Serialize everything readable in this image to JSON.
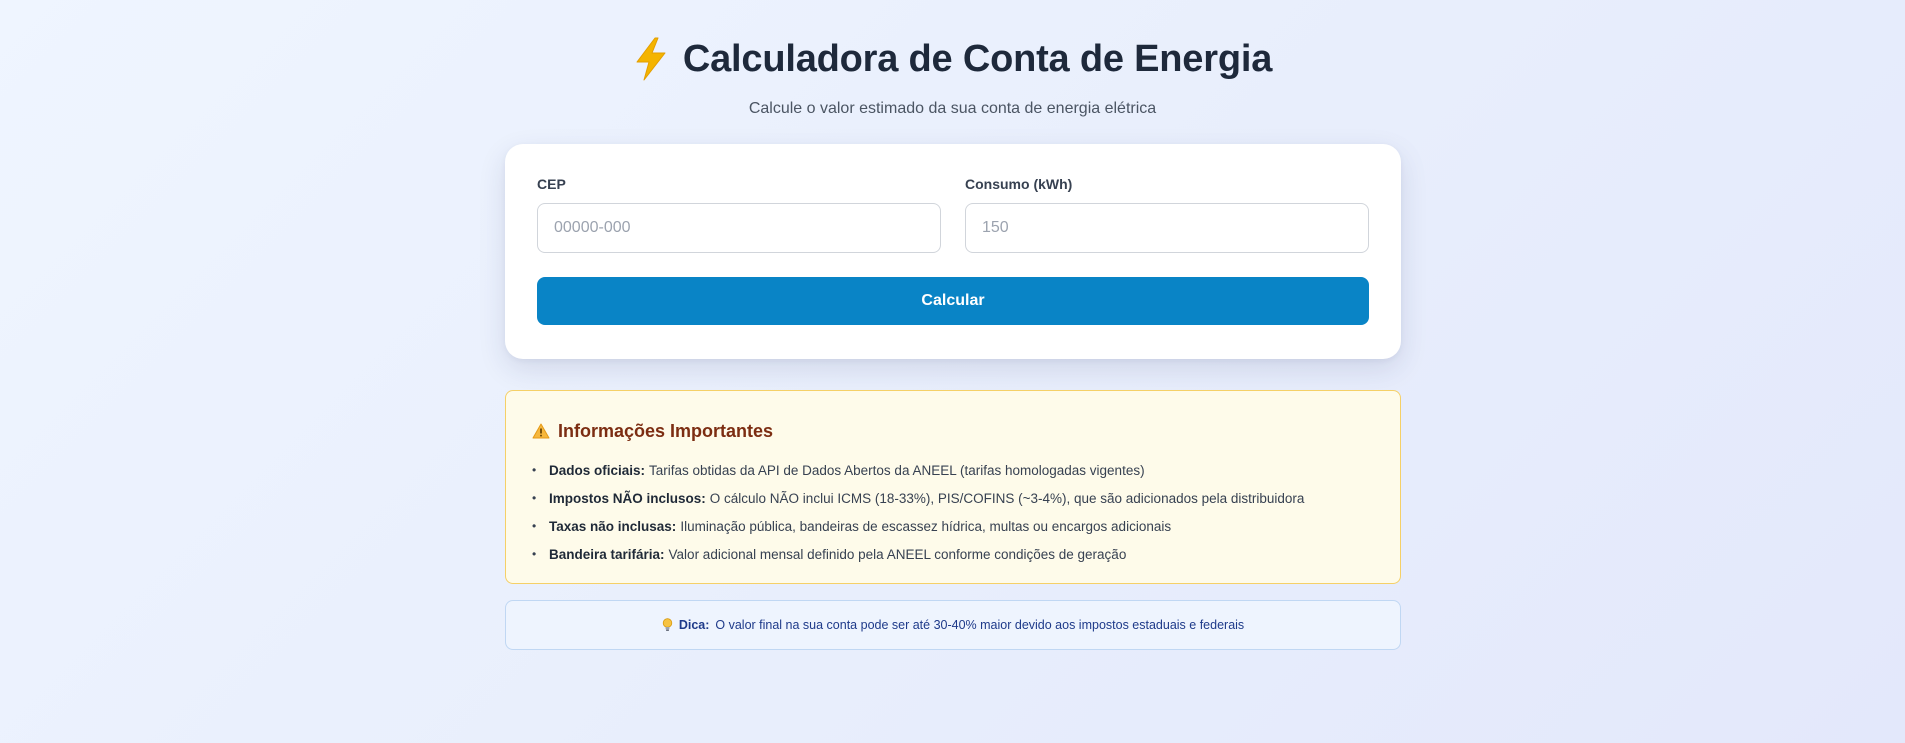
{
  "header": {
    "title": "Calculadora de Conta de Energia",
    "subtitle": "Calcule o valor estimado da sua conta de energia elétrica",
    "icon": "lightning-bolt-icon"
  },
  "form": {
    "cep_label": "CEP",
    "cep_placeholder": "00000-000",
    "cep_value": "",
    "consumo_label": "Consumo (kWh)",
    "consumo_placeholder": "150",
    "consumo_value": "",
    "submit_label": "Calcular"
  },
  "info": {
    "icon": "warning-icon",
    "title": "Informações Importantes",
    "items": [
      {
        "label": "Dados oficiais:",
        "text": "Tarifas obtidas da API de Dados Abertos da ANEEL (tarifas homologadas vigentes)"
      },
      {
        "label": "Impostos NÃO inclusos:",
        "text": "O cálculo NÃO inclui ICMS (18-33%), PIS/COFINS (~3-4%), que são adicionados pela distribuidora"
      },
      {
        "label": "Taxas não inclusas:",
        "text": "Iluminação pública, bandeiras de escassez hídrica, multas ou encargos adicionais"
      },
      {
        "label": "Bandeira tarifária:",
        "text": "Valor adicional mensal definido pela ANEEL conforme condições de geração"
      }
    ]
  },
  "tip": {
    "icon": "lightbulb-icon",
    "label": "Dica:",
    "text": "O valor final na sua conta pode ser até 30-40% maior devido aos impostos estaduais e federais"
  },
  "colors": {
    "primary_button": "#0984c6",
    "warning_bg": "#fefbea",
    "warning_border": "#f5d067",
    "tip_bg": "#eef4fe",
    "bolt": "#f4b400"
  }
}
